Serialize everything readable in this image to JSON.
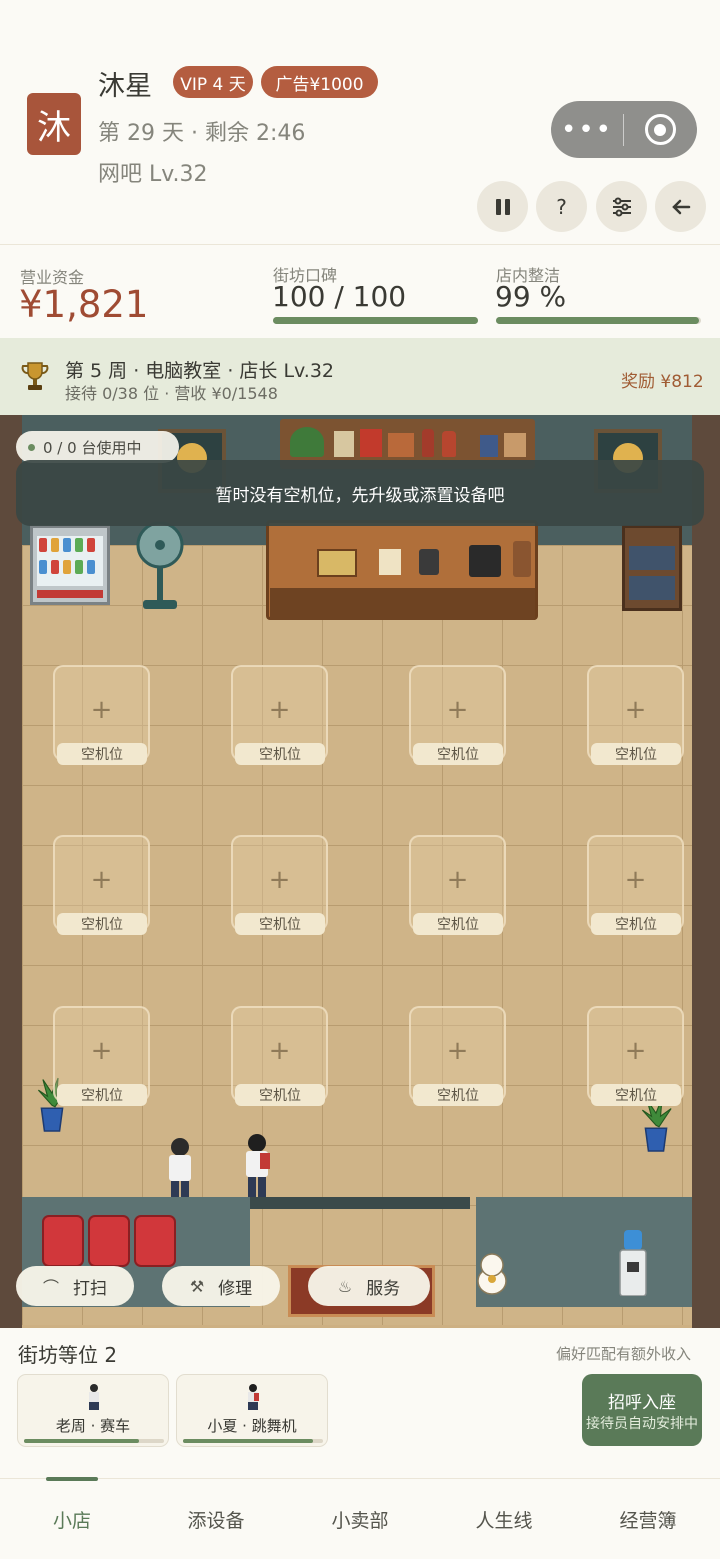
{
  "header": {
    "avatar_char": "沐",
    "name": "沐星",
    "vip_badge": "VIP 4 天",
    "ad_badge": "广告¥1000",
    "day_line": "第 29 天 · 剩余 2:46",
    "shop_line": "网吧 Lv.32",
    "capsule_more": "•••",
    "buttons": {
      "pause": "❚❚",
      "help": "?",
      "settings": "⚙",
      "back": "←"
    }
  },
  "stats": {
    "funds_label": "营业资金",
    "funds_value": "¥1,821",
    "reputation_label": "街坊口碑",
    "reputation_value": "100 / 100",
    "reputation_fill": 1.0,
    "cleanliness_label": "店内整洁",
    "cleanliness_value": "99 %",
    "cleanliness_fill": 0.99,
    "accent": "#6b8c60",
    "funds_color": "#9f4b33"
  },
  "weekly": {
    "icon": "trophy-icon",
    "title": "第 5 周 · 电脑教室 · 店长 Lv.32",
    "subtitle": "接待 0/38 位 · 营收 ¥0/1548",
    "reward": "奖励 ¥812"
  },
  "shop": {
    "usage": "0 / 0 台使用中",
    "toast": "暂时没有空机位，先升级或添置设备吧",
    "slot_plus": "+",
    "slots": [
      {
        "label": "空机位"
      },
      {
        "label": "空机位"
      },
      {
        "label": "空机位"
      },
      {
        "label": "空机位"
      },
      {
        "label": "空机位"
      },
      {
        "label": "空机位"
      },
      {
        "label": "空机位"
      },
      {
        "label": "空机位"
      },
      {
        "label": "空机位"
      },
      {
        "label": "空机位"
      },
      {
        "label": "空机位"
      },
      {
        "label": "空机位"
      }
    ],
    "actions": {
      "sweep": "打扫",
      "repair": "修理",
      "serve": "服务"
    }
  },
  "queue": {
    "title": "街坊等位 2",
    "hint": "偏好匹配有额外收入",
    "customers": [
      {
        "label": "老周 · 赛车",
        "patience": 0.82
      },
      {
        "label": "小夏 · 跳舞机",
        "patience": 0.93
      }
    ],
    "greet_main": "招呼入座",
    "greet_sub": "接待员自动安排中"
  },
  "tabs": [
    "小店",
    "添设备",
    "小卖部",
    "人生线",
    "经营簿"
  ],
  "active_tab": 0
}
